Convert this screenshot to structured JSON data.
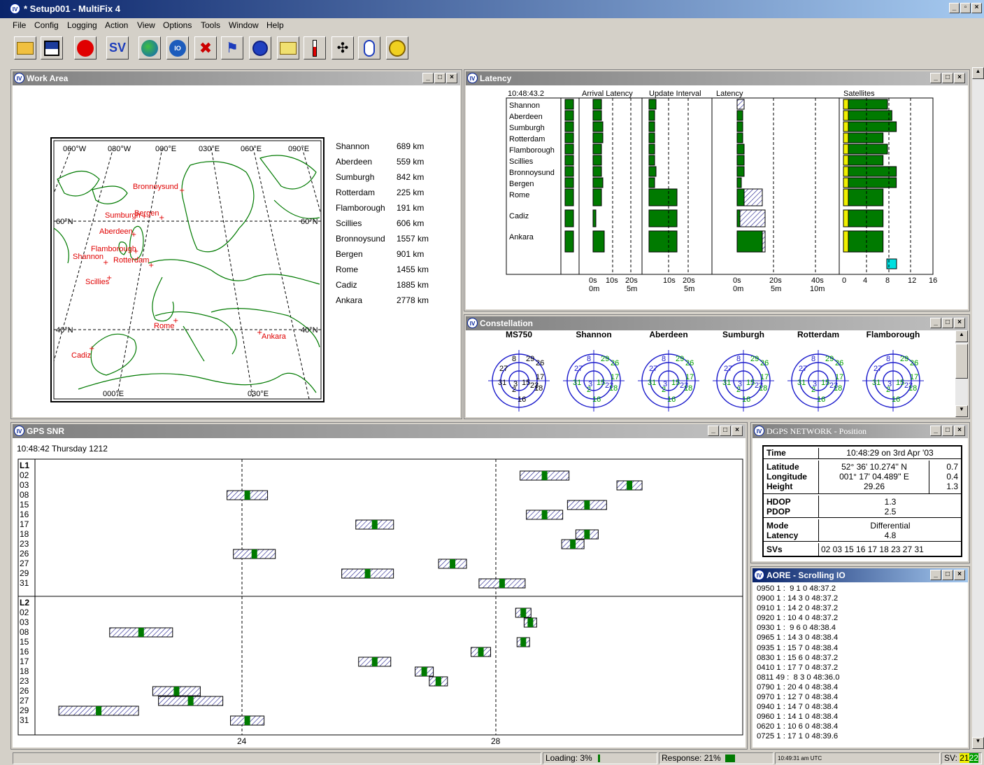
{
  "app": {
    "title": "* Setup001 - MultiFix 4",
    "icon": "IV"
  },
  "menu": [
    "File",
    "Config",
    "Logging",
    "Action",
    "View",
    "Options",
    "Tools",
    "Window",
    "Help"
  ],
  "toolbar": [
    "open-icon",
    "save-icon",
    "record-icon",
    "sv-icon",
    "globe-icon",
    "io-icon",
    "tools-icon",
    "flags-icon",
    "stopwatch-icon",
    "mail-icon",
    "thermometer-icon",
    "network-icon",
    "mouse-icon",
    "clock-icon"
  ],
  "toolbar_sv": "SV",
  "work": {
    "title": "Work Area",
    "grid": {
      "lon": [
        "060°W",
        "030°W",
        "000°E",
        "030°E",
        "060°E",
        "090°E"
      ],
      "lat_left": [
        "60°N",
        "40°N"
      ],
      "lat_right": [
        "60°N",
        "40°N"
      ],
      "bottom": [
        "000°E",
        "030°E"
      ]
    },
    "places": [
      "Bronnoysund",
      "Sumburgh",
      "Bergen",
      "Aberdeen",
      "Flamborough",
      "Shannon",
      "Scillies",
      "Rotterdam",
      "Rome",
      "Ankara",
      "Cadiz"
    ],
    "ranges": [
      {
        "n": "Shannon",
        "d": "689 km"
      },
      {
        "n": "Aberdeen",
        "d": "559 km"
      },
      {
        "n": "Sumburgh",
        "d": "842 km"
      },
      {
        "n": "Rotterdam",
        "d": "225 km"
      },
      {
        "n": "Flamborough",
        "d": "191 km"
      },
      {
        "n": "Scillies",
        "d": "606 km"
      },
      {
        "n": "Bronnoysund",
        "d": "1557 km"
      },
      {
        "n": "Bergen",
        "d": "901 km"
      },
      {
        "n": "Rome",
        "d": "1455 km"
      },
      {
        "n": "Cadiz",
        "d": "1885 km"
      },
      {
        "n": "Ankara",
        "d": "2778 km"
      }
    ]
  },
  "latency": {
    "title": "Latency",
    "time": "10:48:43.2",
    "cols": [
      "Arrival Latency",
      "Update Interval",
      "Latency",
      "Satellites"
    ],
    "stations": [
      "Shannon",
      "Aberdeen",
      "Sumburgh",
      "Rotterdam",
      "Flamborough",
      "Scillies",
      "Bronnoysund",
      "Bergen",
      "Rome",
      "Cadiz",
      "Ankara"
    ],
    "ticks": {
      "arrival": [
        "0s",
        "10s",
        "20s"
      ],
      "arrival2": [
        "0m",
        "5m"
      ],
      "update": [
        "10s",
        "20s"
      ],
      "update2": [
        "5m"
      ],
      "lat": [
        "0s",
        "20s",
        "40s"
      ],
      "lat2": [
        "0m",
        "5m",
        "10m"
      ],
      "sat": [
        "0",
        "4",
        "8",
        "12",
        "16"
      ]
    },
    "arrival": [
      0.3,
      0.3,
      0.35,
      0.35,
      0.3,
      0.3,
      0.3,
      0.35,
      0.3,
      0.1,
      0.4
    ],
    "update": [
      0.25,
      0.2,
      0.2,
      0.2,
      0.2,
      0.2,
      0.25,
      0.2,
      1.0,
      1.0,
      1.0
    ],
    "lat_box": [
      0.25,
      0.2,
      0.2,
      0.2,
      0.25,
      0.25,
      0.25,
      0.15,
      0.9,
      1.0,
      1.0
    ],
    "lat_fill": [
      0.0,
      0.2,
      0.2,
      0.2,
      0.25,
      0.25,
      0.25,
      0.15,
      0.25,
      0.1,
      0.9
    ],
    "sats": [
      10,
      11,
      12,
      9,
      10,
      9,
      12,
      12,
      9,
      9,
      9
    ]
  },
  "constellation": {
    "title": "Constellation",
    "stations": [
      "MS750",
      "Shannon",
      "Aberdeen",
      "Sumburgh",
      "Rotterdam",
      "Flamborough"
    ],
    "svs": [
      "8",
      "29",
      "26",
      "27",
      "17",
      "31",
      "3",
      "2",
      "15",
      "23",
      "18",
      "16"
    ]
  },
  "snr": {
    "title": "GPS SNR",
    "time": "10:48:42 Thursday 1212",
    "l1": "L1",
    "l2": "L2",
    "l1svs": [
      "02",
      "03",
      "08",
      "15",
      "16",
      "17",
      "18",
      "23",
      "26",
      "27",
      "29",
      "31"
    ],
    "l2svs": [
      "02",
      "03",
      "08",
      "15",
      "16",
      "17",
      "18",
      "23",
      "26",
      "27",
      "29",
      "31"
    ],
    "xlabels": [
      "24",
      "28"
    ],
    "l1bars": [
      [
        0,
        72
      ],
      [
        1,
        84
      ],
      [
        2,
        30
      ],
      [
        3,
        78
      ],
      [
        4,
        72
      ],
      [
        5,
        48
      ],
      [
        6,
        78
      ],
      [
        7,
        76
      ],
      [
        8,
        31
      ],
      [
        9,
        59
      ],
      [
        10,
        47
      ],
      [
        11,
        66
      ]
    ],
    "l2bars": [
      [
        0,
        69
      ],
      [
        1,
        70
      ],
      [
        2,
        15
      ],
      [
        3,
        69
      ],
      [
        4,
        63
      ],
      [
        5,
        48
      ],
      [
        6,
        55
      ],
      [
        7,
        57
      ],
      [
        8,
        20
      ],
      [
        9,
        22
      ],
      [
        10,
        9
      ],
      [
        11,
        30
      ]
    ]
  },
  "dgps": {
    "title": "DGPS NETWORK - Position",
    "rows": [
      {
        "k": "Time",
        "v": "10:48:29 on 3rd Apr '03",
        "e": ""
      },
      {
        "k": "Latitude",
        "v": "52° 36' 10.274'' N",
        "e": "0.7"
      },
      {
        "k": "Longitude",
        "v": "001° 17' 04.489'' E",
        "e": "0.4"
      },
      {
        "k": "Height",
        "v": "29.26",
        "e": "1.3"
      },
      {
        "k": "HDOP",
        "v": "1.3",
        "e": ""
      },
      {
        "k": "PDOP",
        "v": "2.5",
        "e": ""
      },
      {
        "k": "Mode",
        "v": "Differential",
        "e": ""
      },
      {
        "k": "Latency",
        "v": "4.8",
        "e": ""
      },
      {
        "k": "SVs",
        "v": "02 03 15 16 17 18 23 27 31",
        "e": ""
      }
    ]
  },
  "scroll": {
    "title": "AORE - Scrolling IO",
    "lines": [
      "0950 1 :  9 1 0 48:37.2",
      "0900 1 : 14 3 0 48:37.2",
      "0910 1 : 14 2 0 48:37.2",
      "0920 1 : 10 4 0 48:37.2",
      "0930 1 :  9 6 0 48:38.4",
      "0965 1 : 14 3 0 48:38.4",
      "0935 1 : 15 7 0 48:38.4",
      "0830 1 : 15 6 0 48:37.2",
      "0410 1 : 17 7 0 48:37.2",
      "0811 49 :  8 3 0 48:36.0",
      "0790 1 : 20 4 0 48:38.4",
      "0970 1 : 12 7 0 48:38.4",
      "0940 1 : 14 7 0 48:38.4",
      "0960 1 : 14 1 0 48:38.4",
      "0620 1 : 10 6 0 48:38.4",
      "0725 1 : 17 1 0 48:39.6"
    ]
  },
  "status": {
    "loading": "Loading: 3%",
    "response": "Response: 21%",
    "utc": "10:49:31 am UTC",
    "sv": "SV: ",
    "sv_a": "21",
    "sv_b": "22"
  },
  "colors": {
    "green": "#007a00",
    "red": "#e00000",
    "navy": "#0a246a"
  }
}
